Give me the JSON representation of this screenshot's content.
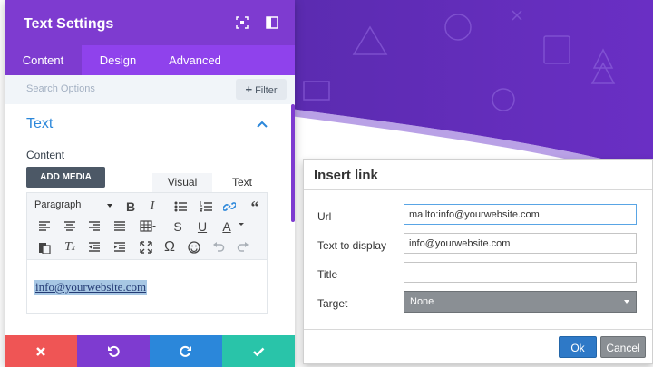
{
  "panel": {
    "title": "Text Settings",
    "tabs": [
      {
        "label": "Content",
        "active": true
      },
      {
        "label": "Design",
        "active": false
      },
      {
        "label": "Advanced",
        "active": false
      }
    ],
    "search_placeholder": "Search Options",
    "filter_label": "Filter",
    "section_title": "Text",
    "content_label": "Content",
    "add_media_label": "ADD MEDIA",
    "editor_tabs": {
      "visual": "Visual",
      "text": "Text"
    },
    "format_select": "Paragraph",
    "editor_content": "info@yourwebsite.com",
    "icons": {
      "header": [
        "expand-icon",
        "sidebar-toggle-icon"
      ],
      "toolbar_row1": [
        "bold-icon",
        "italic-icon",
        "bullet-list-icon",
        "numbered-list-icon",
        "link-icon",
        "blockquote-icon"
      ],
      "toolbar_row2": [
        "align-left-icon",
        "align-center-icon",
        "align-right-icon",
        "align-justify-icon",
        "table-icon",
        "strikethrough-icon",
        "underline-icon",
        "text-color-icon"
      ],
      "toolbar_row3": [
        "paste-icon",
        "clear-format-icon",
        "outdent-icon",
        "indent-icon",
        "fullscreen-icon",
        "omega-icon",
        "emoji-icon",
        "undo-icon",
        "redo-icon"
      ],
      "footer": [
        "close-icon",
        "undo-icon",
        "redo-icon",
        "check-icon"
      ]
    }
  },
  "dialog": {
    "title": "Insert link",
    "fields": {
      "url_label": "Url",
      "url_value": "mailto:info@yourwebsite.com",
      "display_label": "Text to display",
      "display_value": "info@yourwebsite.com",
      "title_label": "Title",
      "title_value": "",
      "target_label": "Target",
      "target_value": "None"
    },
    "ok_label": "Ok",
    "cancel_label": "Cancel"
  },
  "colors": {
    "purple": "#7e3bd0",
    "tab_purple": "#8f42ec",
    "blue": "#2b87da",
    "red": "#ef5555",
    "teal": "#29c4a9"
  }
}
